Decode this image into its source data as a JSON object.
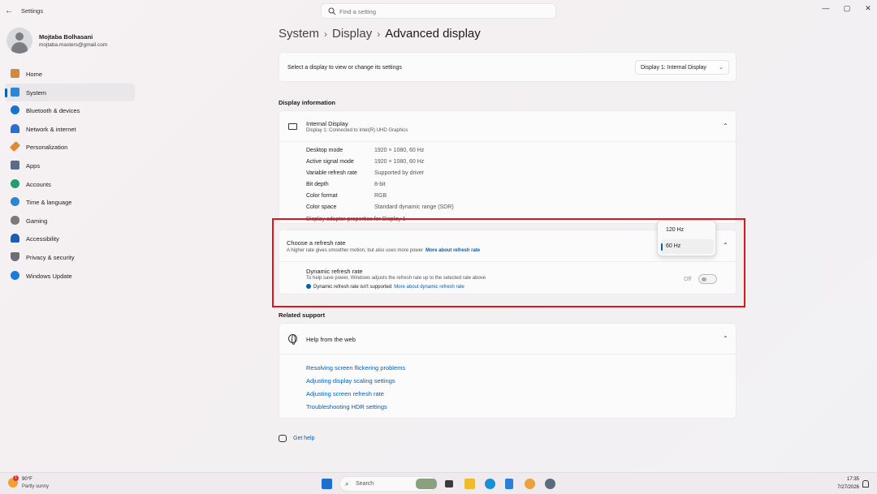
{
  "window": {
    "app_title": "Settings",
    "search_placeholder": "Find a setting",
    "minimize": "—",
    "maximize": "▢",
    "close": "✕"
  },
  "profile": {
    "name": "Mojtaba Bolhasani",
    "email": "mojtaba.masters@gmail.com"
  },
  "sidebar": {
    "items": [
      {
        "label": "Home",
        "icon": "home-icon",
        "color": "#d08a3c"
      },
      {
        "label": "System",
        "icon": "monitor-icon",
        "color": "#2b88d8"
      },
      {
        "label": "Bluetooth & devices",
        "icon": "bluetooth-icon",
        "color": "#1a73c9"
      },
      {
        "label": "Network & internet",
        "icon": "wifi-icon",
        "color": "#2b6fd6"
      },
      {
        "label": "Personalization",
        "icon": "brush-icon",
        "color": "#e08b30"
      },
      {
        "label": "Apps",
        "icon": "apps-icon",
        "color": "#5b6b8a"
      },
      {
        "label": "Accounts",
        "icon": "person-icon",
        "color": "#1f9e6e"
      },
      {
        "label": "Time & language",
        "icon": "globe-clock-icon",
        "color": "#2a86d1"
      },
      {
        "label": "Gaming",
        "icon": "gamepad-icon",
        "color": "#7a7a7a"
      },
      {
        "label": "Accessibility",
        "icon": "accessibility-icon",
        "color": "#1b5fb5"
      },
      {
        "label": "Privacy & security",
        "icon": "shield-icon",
        "color": "#6d6d74"
      },
      {
        "label": "Windows Update",
        "icon": "update-icon",
        "color": "#1f7bd6"
      }
    ]
  },
  "breadcrumb": {
    "level1": "System",
    "level2": "Display",
    "current": "Advanced display"
  },
  "display_select": {
    "label": "Select a display to view or change its settings",
    "value": "Display 1: Internal Display"
  },
  "display_info": {
    "section_title": "Display information",
    "name": "Internal Display",
    "subtitle": "Display 1: Connected to Intel(R) UHD Graphics",
    "properties": [
      {
        "label": "Desktop mode",
        "value": "1920 × 1080, 60 Hz"
      },
      {
        "label": "Active signal mode",
        "value": "1920 × 1080, 60 Hz"
      },
      {
        "label": "Variable refresh rate",
        "value": "Supported by driver"
      },
      {
        "label": "Bit depth",
        "value": "8-bit"
      },
      {
        "label": "Color format",
        "value": "RGB"
      },
      {
        "label": "Color space",
        "value": "Standard dynamic range (SDR)"
      }
    ],
    "adapter_link": "Display adapter properties for Display 1"
  },
  "refresh": {
    "title": "Choose a refresh rate",
    "description": "A higher rate gives smoother motion, but also uses more power",
    "more_link": "More about refresh rate",
    "options": [
      "120 Hz",
      "60 Hz"
    ],
    "selected": "60 Hz",
    "dynamic": {
      "title": "Dynamic refresh rate",
      "description": "To help save power, Windows adjusts the refresh rate up to the selected rate above",
      "warning": "Dynamic refresh rate isn't supported",
      "link": "More about dynamic refresh rate",
      "toggle_state": "Off"
    }
  },
  "related_support": {
    "section_title": "Related support",
    "help_title": "Help from the web",
    "links": [
      "Resolving screen flickering problems",
      "Adjusting display scaling settings",
      "Adjusting screen refresh rate",
      "Troubleshooting HDR settings"
    ]
  },
  "get_help": "Get help",
  "taskbar": {
    "weather_temp": "90°F",
    "weather_desc": "Partly sunny",
    "weather_badge": "1",
    "search_label": "Search",
    "time": "17:35",
    "date": "7/27/2026",
    "colors": {
      "start": "#1f6fd1",
      "explorer": "#f1b92c",
      "edge": "#1a8fd6",
      "store": "#2b7fd6",
      "settings": "#5e6b7d"
    }
  },
  "accent_color": "#005fb8",
  "highlight_color": "#e0151b"
}
